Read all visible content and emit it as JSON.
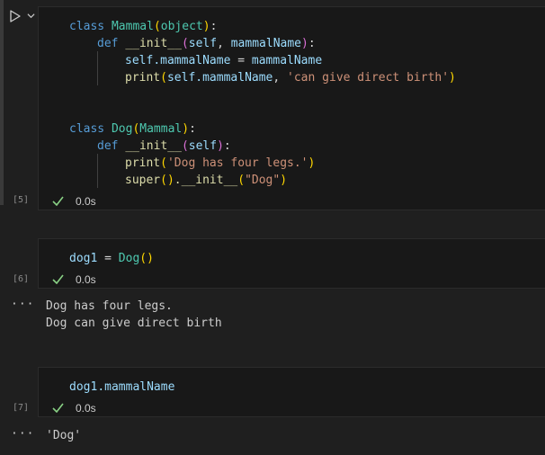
{
  "cells": [
    {
      "execution_count": "[5]",
      "timing": "0.0s",
      "code": {
        "l1": {
          "kw": "class",
          "name": "Mammal",
          "arg": "object",
          "colon": ":"
        },
        "l2": {
          "kw": "def",
          "name": "__init__",
          "self": "self",
          "comma": ", ",
          "param": "mammalName",
          "colon": ":"
        },
        "l3": {
          "obj": "self",
          "attr": ".mammalName",
          "eq": " = ",
          "val": "mammalName"
        },
        "l4": {
          "fn": "print",
          "obj": "self",
          "attr": ".mammalName",
          "comma": ", ",
          "str": "'can give direct birth'"
        },
        "l5": {
          "kw": "class",
          "name": "Dog",
          "arg": "Mammal",
          "colon": ":"
        },
        "l6": {
          "kw": "def",
          "name": "__init__",
          "self": "self",
          "colon": ":"
        },
        "l7": {
          "fn": "print",
          "str": "'Dog has four legs.'"
        },
        "l8": {
          "fn": "super",
          "call": "()",
          "attr": ".__init__",
          "str": "\"Dog\""
        }
      }
    },
    {
      "execution_count": "[6]",
      "timing": "0.0s",
      "code": {
        "var": "dog1",
        "eq": " = ",
        "cls": "Dog",
        "call": "()"
      },
      "output_marker": "···",
      "output": [
        "Dog has four legs.",
        "Dog can give direct birth"
      ]
    },
    {
      "execution_count": "[7]",
      "timing": "0.0s",
      "code": {
        "var": "dog1",
        "attr": ".mammalName"
      },
      "output_marker": "···",
      "output": [
        "'Dog'"
      ]
    }
  ],
  "icons": {
    "run": "play-icon",
    "chevron": "chevron-down-icon",
    "success": "check-icon"
  },
  "colors": {
    "keyword": "#569cd6",
    "class": "#4ec9b0",
    "function": "#dcdcaa",
    "variable": "#9cdcfe",
    "string": "#ce9178",
    "success": "#89d185"
  }
}
